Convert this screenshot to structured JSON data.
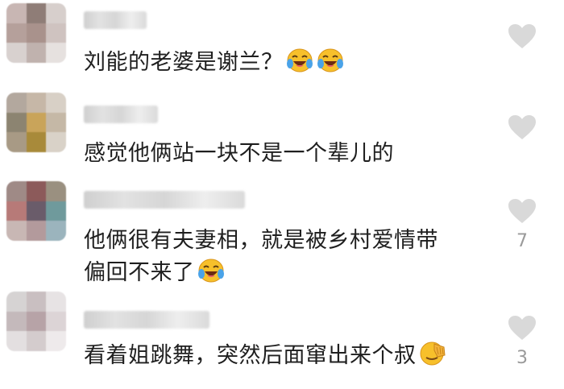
{
  "comments": [
    {
      "text": "刘能的老婆是谢兰？",
      "emojis": [
        "laughing-crying-emoji",
        "laughing-crying-emoji"
      ],
      "likes": ""
    },
    {
      "text": "感觉他俩站一块不是一个辈儿的",
      "emojis": [],
      "likes": ""
    },
    {
      "text_line1": "他俩很有夫妻相，就是被乡村爱情带",
      "text_line2": "偏回不来了",
      "emojis": [
        "laughing-crying-emoji"
      ],
      "likes": "7"
    },
    {
      "text": "看着姐跳舞，突然后面窜出来个叔",
      "emojis": [
        "facepalm-emoji"
      ],
      "likes": "3"
    }
  ],
  "colors": {
    "heart": "#d9d9d9",
    "text": "#1f1f1f",
    "count": "#9a9a9a"
  }
}
